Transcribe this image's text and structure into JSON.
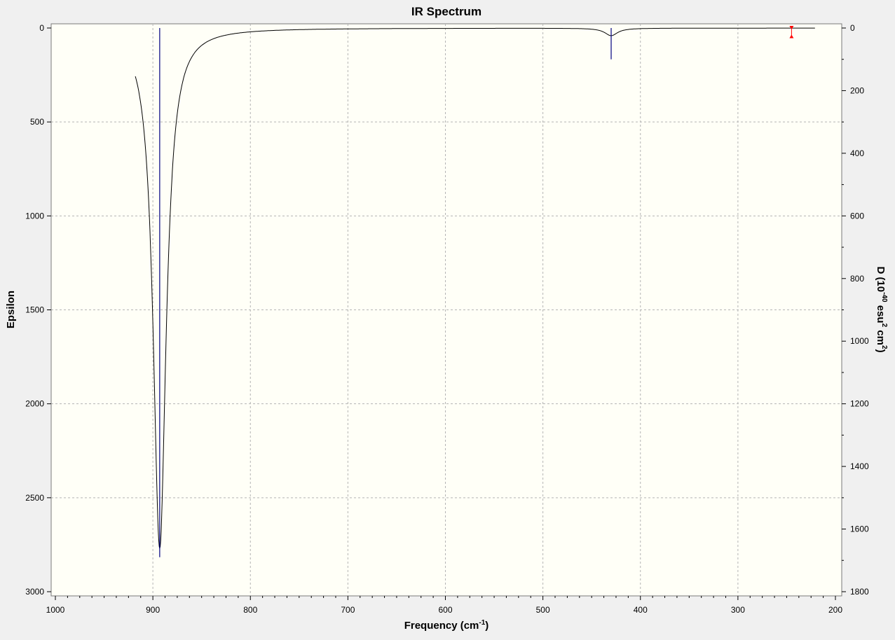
{
  "chart_data": {
    "type": "line",
    "title": "IR Spectrum",
    "xlabel": {
      "main": "Frequency (cm",
      "sup": "-1",
      "tail": ")"
    },
    "ylabel_left": "Epsilon",
    "ylabel_right": {
      "p1": "D (10",
      "s1": "-40",
      "p2": " esu",
      "s2": "2",
      "p3": " cm",
      "s3": "2",
      "p4": ")"
    },
    "xlim": [
      1000,
      200
    ],
    "ylim_left": [
      0,
      3000
    ],
    "ylim_right": [
      0,
      1800
    ],
    "x_ticks": [
      "1000",
      "900",
      "800",
      "700",
      "600",
      "500",
      "400",
      "300",
      "200"
    ],
    "y_left_ticks": [
      "0",
      "500",
      "1000",
      "1500",
      "2000",
      "2500",
      "3000"
    ],
    "y_right_ticks": [
      "0",
      "200",
      "400",
      "600",
      "800",
      "1000",
      "1200",
      "1400",
      "1600",
      "1800"
    ],
    "grid": true,
    "spectrum_range": [
      918,
      221
    ],
    "peaks": [
      {
        "freq": 893,
        "epsilon": 2770,
        "intensity_D": 1690
      },
      {
        "freq": 430,
        "epsilon": 40,
        "intensity_D": 100
      }
    ],
    "marker": {
      "freq": 245,
      "intensity_D": 28
    },
    "colors": {
      "plot_bg": "#fffff7",
      "page_bg": "#f0f0f0",
      "spectrum": "#000000",
      "sticks": "#000080",
      "grid": "#b4b4b4",
      "marker": "#ff0000"
    }
  }
}
